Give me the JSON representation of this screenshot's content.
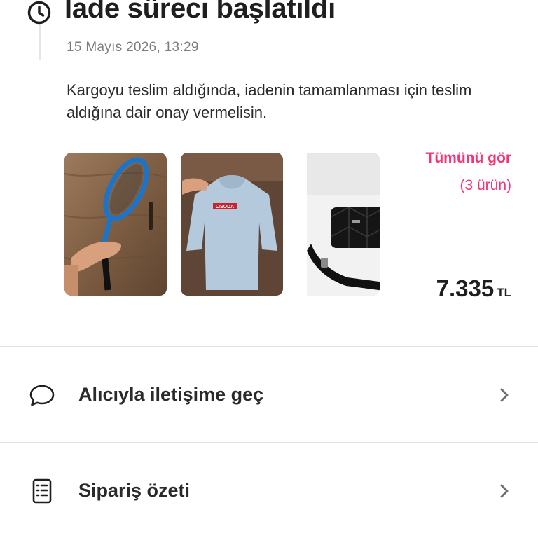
{
  "header": {
    "title": "İade süreci başlatıldı",
    "timestamp": "15 Mayıs 2026, 13:29",
    "description": "Kargoyu teslim aldığında, iadenin tamamlanması için teslim aldığına dair onay vermelisin."
  },
  "products": {
    "items": [
      {
        "name": "tennis-racket",
        "icon": "tennis-racket-image"
      },
      {
        "name": "light-blue-hoodie",
        "icon": "hoodie-image"
      },
      {
        "name": "black-shoulder-bag",
        "icon": "bag-image"
      }
    ],
    "see_all_label": "Tümünü gör",
    "count_label": "(3 ürün)",
    "price": "7.335",
    "currency": "TL"
  },
  "actions": {
    "contact_label": "Alıcıyla iletişime geç",
    "summary_label": "Sipariş özeti"
  },
  "colors": {
    "accent": "#f0357a",
    "text": "#1f1f1f",
    "muted": "#7d7d7d"
  }
}
